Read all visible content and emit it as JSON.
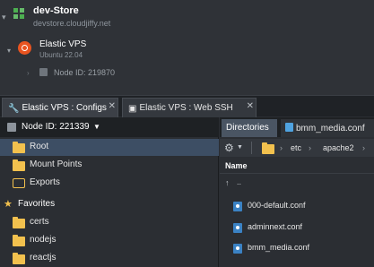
{
  "environment": {
    "name": "dev-Store",
    "domain": "devstore.cloudjiffy.net",
    "node": {
      "title": "Elastic VPS",
      "os": "Ubuntu 22.04",
      "node_id_label": "Node ID: 219870"
    }
  },
  "tabs": [
    {
      "label": "Elastic VPS : Configs",
      "active": true
    },
    {
      "label": "Elastic VPS : Web SSH",
      "active": false
    }
  ],
  "left_pane": {
    "node_selector": "Node ID: 221339",
    "items": [
      {
        "label": "Root",
        "selected": true
      },
      {
        "label": "Mount Points"
      },
      {
        "label": "Exports"
      }
    ],
    "favorites_label": "Favorites",
    "favorites": [
      {
        "label": "certs"
      },
      {
        "label": "nodejs"
      },
      {
        "label": "reactjs"
      }
    ]
  },
  "right_pane": {
    "tabs": [
      {
        "label": "Directories",
        "active": true
      },
      {
        "label": "bmm_media.conf",
        "active": false
      }
    ],
    "path": [
      "etc",
      "apache2"
    ],
    "column_name": "Name",
    "up_label": "..",
    "files": [
      {
        "name": "000-default.conf"
      },
      {
        "name": "adminnext.conf"
      },
      {
        "name": "bmm_media.conf"
      }
    ]
  },
  "colors": {
    "selection": "#3d4e64",
    "folder": "#f2c14e",
    "ubuntu": "#e95420",
    "file_icon": "#3b82c4"
  }
}
